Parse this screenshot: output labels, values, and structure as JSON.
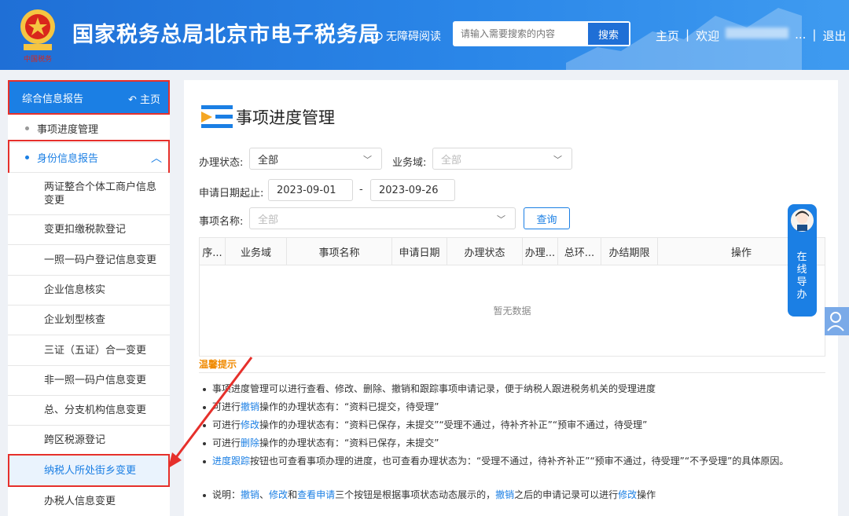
{
  "header": {
    "title": "国家税务总局北京市电子税务局",
    "accessibility": "无障碍阅读",
    "search_placeholder": "请输入需要搜索的内容",
    "search_button": "搜索",
    "nav_home": "主页",
    "nav_welcome": "欢迎",
    "nav_user_suffix": "...",
    "nav_logout": "退出",
    "emblem_text": "中国税务"
  },
  "sidebar": {
    "head_label": "综合信息报告",
    "head_home": "主页",
    "items": [
      {
        "label": "事项进度管理"
      },
      {
        "label": "身份信息报告"
      },
      {
        "label": "两证整合个体工商户信息变更"
      },
      {
        "label": "变更扣缴税款登记"
      },
      {
        "label": "一照一码户登记信息变更"
      },
      {
        "label": "企业信息核实"
      },
      {
        "label": "企业划型核查"
      },
      {
        "label": "三证（五证）合一变更"
      },
      {
        "label": "非一照一码户信息变更"
      },
      {
        "label": "总、分支机构信息变更"
      },
      {
        "label": "跨区税源登记"
      },
      {
        "label": "纳税人所处街乡变更"
      },
      {
        "label": "办税人信息变更"
      }
    ]
  },
  "main": {
    "title": "事项进度管理",
    "filters": {
      "status_label": "办理状态:",
      "status_value": "全部",
      "domain_label": "业务域:",
      "domain_placeholder": "全部",
      "date_label": "申请日期起止:",
      "date_from": "2023-09-01",
      "date_sep": "-",
      "date_to": "2023-09-26",
      "name_label": "事项名称:",
      "name_placeholder": "全部",
      "query_button": "查询"
    },
    "table": {
      "columns": [
        "序...",
        "业务域",
        "事项名称",
        "申请日期",
        "办理状态",
        "办理...",
        "总环...",
        "办结期限",
        "操作"
      ],
      "empty_text": "暂无数据"
    },
    "tips": {
      "title": "温馨提示",
      "t1": "事项进度管理可以进行查看、修改、删除、撤销和跟踪事项申请记录，便于纳税人跟进税务机关的受理进度",
      "t2a": "可进行",
      "t2b": "撤销",
      "t2c": "操作的办理状态有：“资料已提交，待受理”",
      "t3a": "可进行",
      "t3b": "修改",
      "t3c": "操作的办理状态有：“资料已保存，未提交”“受理不通过，待补齐补正”“预审不通过，待受理”",
      "t4a": "可进行",
      "t4b": "删除",
      "t4c": "操作的办理状态有：“资料已保存，未提交”",
      "t5a": "进度跟踪",
      "t5b": "按钮也可查看事项办理的进度，也可查看办理状态为：“受理不通过，待补齐补正”“预审不通过，待受理”“不予受理”的具体原因。",
      "t6a": "说明：",
      "t6b": "撤销",
      "t6c": "、",
      "t6d": "修改",
      "t6e": "和",
      "t6f": "查看申请",
      "t6g": "三个按钮是根据事项状态动态展示的，",
      "t6h": "撤销",
      "t6i": "之后的申请记录可以进行",
      "t6j": "修改",
      "t6k": "操作"
    }
  },
  "guide": {
    "label": "在线导办"
  },
  "colors": {
    "primary": "#1b7fe4",
    "header": "#2a86e8",
    "highlight": "#e6302b",
    "tips": "#f08a00"
  }
}
